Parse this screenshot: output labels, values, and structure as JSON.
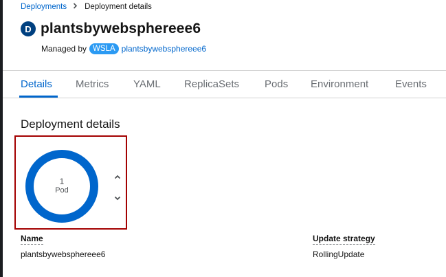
{
  "breadcrumb": {
    "items": [
      "Deployments",
      "Deployment details"
    ]
  },
  "header": {
    "badge": "D",
    "title": "plantsbywebsphereee6",
    "managed_by_label": "Managed by",
    "managed_by_badge": "WSLA",
    "managed_by_name": "plantsbywebsphereee6"
  },
  "tabs": [
    {
      "label": "Details",
      "active": true
    },
    {
      "label": "Metrics",
      "active": false
    },
    {
      "label": "YAML",
      "active": false
    },
    {
      "label": "ReplicaSets",
      "active": false
    },
    {
      "label": "Pods",
      "active": false
    },
    {
      "label": "Environment",
      "active": false
    },
    {
      "label": "Events",
      "active": false
    }
  ],
  "section": {
    "title": "Deployment details"
  },
  "pod_ring": {
    "count": "1",
    "unit": "Pod",
    "ring_color": "#0066cc",
    "increase_icon": "chevron-up-icon",
    "decrease_icon": "chevron-down-icon"
  },
  "details": {
    "name_label": "Name",
    "name_value": "plantsbywebsphereee6",
    "strategy_label": "Update strategy",
    "strategy_value": "RollingUpdate"
  },
  "colors": {
    "link": "#0066cc",
    "highlight_box": "#a30000",
    "badge_dark": "#004080",
    "badge_light": "#2b9af3"
  }
}
